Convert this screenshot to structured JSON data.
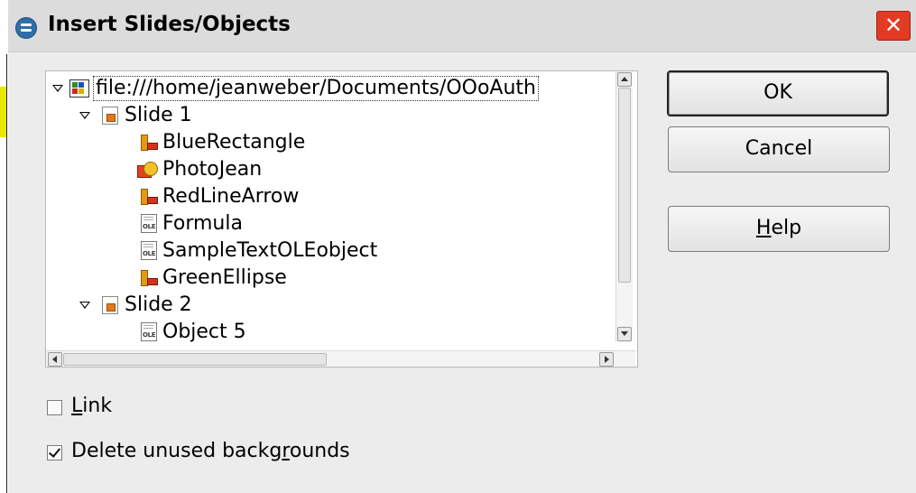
{
  "dialog": {
    "title": "Insert Slides/Objects",
    "close_glyph": "✕"
  },
  "tree": {
    "root": {
      "label": "file:///home/jeanweber/Documents/OOoAuth",
      "icon": "presentation-document-icon"
    },
    "items": [
      {
        "label": "Slide 1",
        "icon": "slide-icon",
        "expanded": true
      },
      {
        "label": "BlueRectangle",
        "icon": "draw-shape-icon"
      },
      {
        "label": "PhotoJean",
        "icon": "image-object-icon"
      },
      {
        "label": "RedLineArrow",
        "icon": "draw-shape-icon"
      },
      {
        "label": "Formula",
        "icon": "ole-object-icon"
      },
      {
        "label": "SampleTextOLEobject",
        "icon": "ole-object-icon"
      },
      {
        "label": "GreenEllipse",
        "icon": "draw-shape-icon"
      },
      {
        "label": "Slide 2",
        "icon": "slide-icon",
        "expanded": true
      },
      {
        "label": "Object 5",
        "icon": "ole-object-icon"
      }
    ],
    "ole_tag": "OLE"
  },
  "buttons": {
    "ok": "OK",
    "cancel": "Cancel",
    "help_mnemonic": "H",
    "help_rest": "elp"
  },
  "options": {
    "link_mnemonic": "L",
    "link_rest": "ink",
    "link_checked": false,
    "delete_prefix": "Delete unused backg",
    "delete_mnemonic": "r",
    "delete_suffix": "ounds",
    "delete_checked": true
  }
}
